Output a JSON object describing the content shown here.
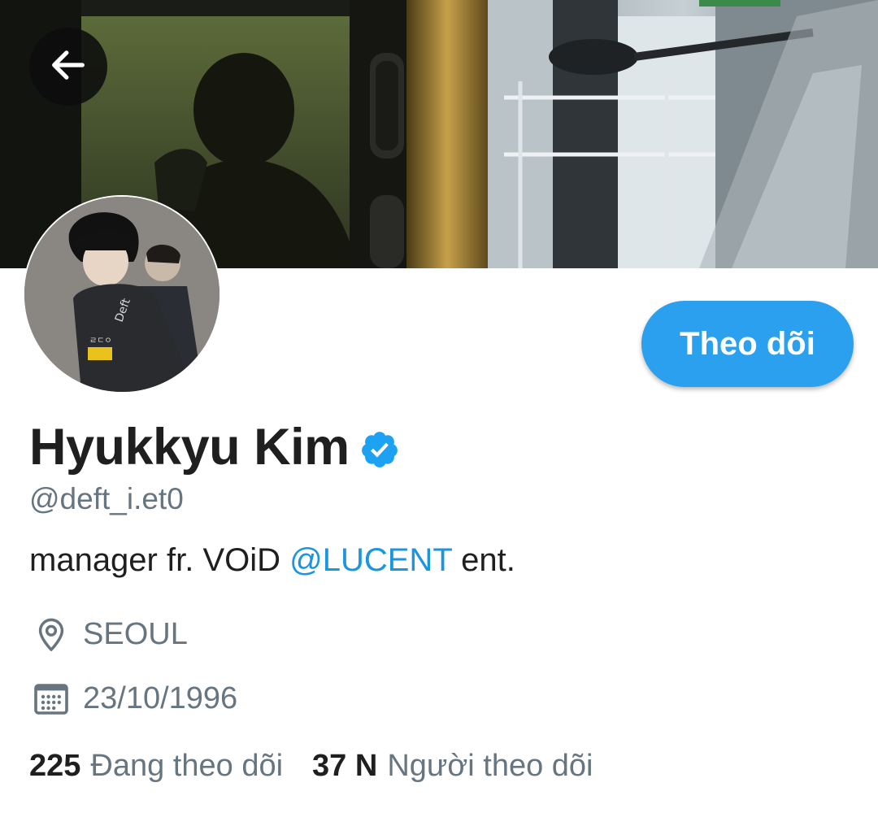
{
  "header": {
    "back_icon": "arrow-left-icon"
  },
  "profile": {
    "display_name": "Hyukkyu Kim",
    "verified_icon": "verified-badge-icon",
    "handle": "@deft_i.et0",
    "bio": {
      "before": "manager fr. VOiD ",
      "mention": "@LUCENT",
      "after": " ent."
    },
    "location": "SEOUL",
    "location_icon": "location-pin-icon",
    "date": "23/10/1996",
    "date_icon": "calendar-icon",
    "following": {
      "count": "225",
      "label": "Đang theo dõi"
    },
    "followers": {
      "count": "37 N",
      "label": "Người theo dõi"
    }
  },
  "actions": {
    "follow_label": "Theo dõi"
  },
  "colors": {
    "accent": "#2aa0ee",
    "mention": "#1b95e0",
    "secondary_text": "#66757f",
    "primary_text": "#1f1f1f",
    "verified": "#1da1f2"
  }
}
